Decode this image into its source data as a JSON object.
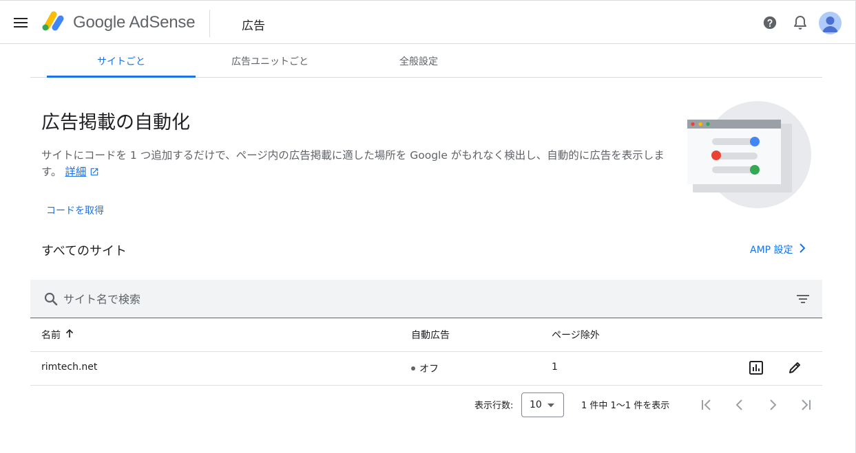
{
  "header": {
    "brand_google": "Google",
    "brand_product": "AdSense",
    "title": "広告"
  },
  "tabs": [
    {
      "label": "サイトごと",
      "active": true
    },
    {
      "label": "広告ユニットごと",
      "active": false
    },
    {
      "label": "全般設定",
      "active": false
    }
  ],
  "hero": {
    "title": "広告掲載の自動化",
    "description": "サイトにコードを 1 つ追加するだけで、ページ内の広告掲載に適した場所を Google がもれなく検出し、自動的に広告を表示します。",
    "learn_more": "詳細",
    "get_code": "コードを取得"
  },
  "sites": {
    "title": "すべてのサイト",
    "amp_link": "AMP 設定",
    "search_placeholder": "サイト名で検索",
    "columns": {
      "name": "名前",
      "auto_ads": "自動広告",
      "page_exclusions": "ページ除外"
    },
    "rows": [
      {
        "name": "rimtech.net",
        "auto_ads": "オフ",
        "page_exclusions": "1"
      }
    ]
  },
  "pagination": {
    "rows_label": "表示行数:",
    "rows_value": "10",
    "range_text": "1 件中 1〜1 件を表示"
  },
  "colors": {
    "accent": "#1a73e8",
    "text": "#202124",
    "secondary": "#5f6368",
    "search_bg": "#f1f3f4"
  },
  "icons": {
    "menu": "menu-icon",
    "help": "help-icon",
    "notifications": "bell-icon",
    "external": "open-in-new-icon",
    "search": "search-icon",
    "filter": "filter-icon",
    "sort": "arrow-upward-icon",
    "report": "bar-chart-icon",
    "edit": "pencil-icon"
  }
}
